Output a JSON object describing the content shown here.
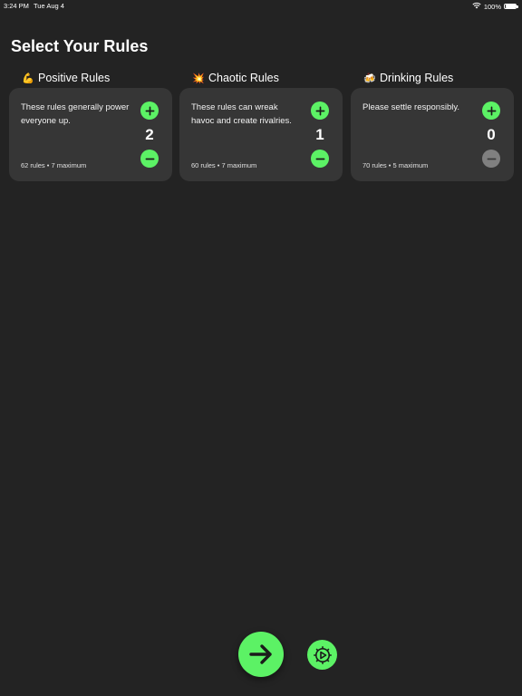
{
  "status_bar": {
    "time": "3:24 PM",
    "date": "Tue Aug 4",
    "battery": "100%",
    "battery_level": 1.0,
    "wifi_icon": "wifi-icon",
    "battery_icon": "battery-icon"
  },
  "page": {
    "title": "Select Your Rules"
  },
  "colors": {
    "background": "#232323",
    "card": "#363636",
    "accent_green": "#5cf265",
    "disabled_gray": "#808080"
  },
  "categories": [
    {
      "emoji": "💪",
      "title": "Positive Rules",
      "description": "These rules generally power everyone up.",
      "count": "2",
      "meta": "62 rules • 7 maximum",
      "minus_enabled": true
    },
    {
      "emoji": "💥",
      "title": "Chaotic Rules",
      "description": "These rules can wreak havoc and create rivalries.",
      "count": "1",
      "meta": "60 rules • 7 maximum",
      "minus_enabled": true
    },
    {
      "emoji": "🍻",
      "title": "Drinking Rules",
      "description": "Please settle responsibly.",
      "count": "0",
      "meta": "70 rules • 5 maximum",
      "minus_enabled": false
    }
  ],
  "bottom_bar": {
    "next_icon": "arrow-right-icon",
    "settings_icon": "gear-play-icon"
  }
}
